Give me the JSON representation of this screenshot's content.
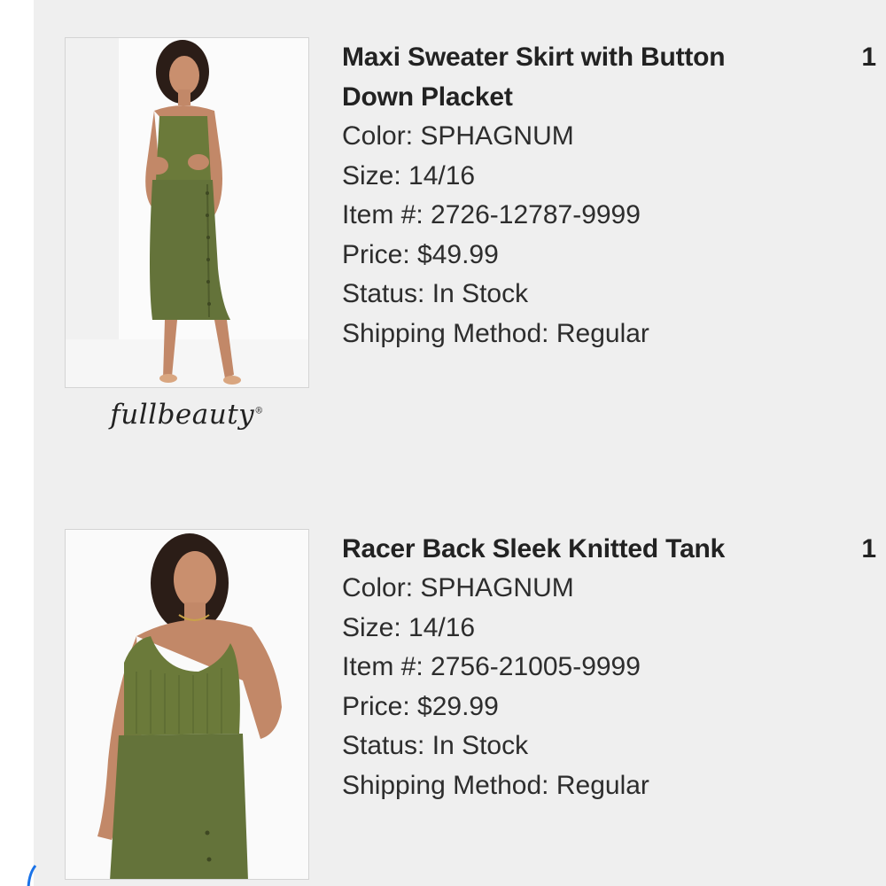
{
  "items": [
    {
      "title": "Maxi Sweater Skirt with Button Down Placket",
      "title_line1": "Maxi Sweater Skirt with Button",
      "title_line2": "Down Placket",
      "quantity": "1",
      "color_label": "Color:",
      "color_value": "SPHAGNUM",
      "size_label": "Size:",
      "size_value": "14/16",
      "item_label": "Item #:",
      "item_value": "2726-12787-9999",
      "price_label": "Price:",
      "price_value": "$49.99",
      "status_label": "Status:",
      "status_value": "In Stock",
      "shipping_label": "Shipping Method:",
      "shipping_value": "Regular",
      "brand": "fullbeauty"
    },
    {
      "title": "Racer Back Sleek Knitted Tank",
      "quantity": "1",
      "color_label": "Color:",
      "color_value": "SPHAGNUM",
      "size_label": "Size:",
      "size_value": "14/16",
      "item_label": "Item #:",
      "item_value": "2756-21005-9999",
      "price_label": "Price:",
      "price_value": "$29.99",
      "status_label": "Status:",
      "status_value": "In Stock",
      "shipping_label": "Shipping Method:",
      "shipping_value": "Regular"
    }
  ],
  "colors": {
    "panel_bg": "#efefef",
    "product_olive": "#6b7a3a",
    "text": "#2d2d2d",
    "accent_blue": "#1a73e8"
  }
}
